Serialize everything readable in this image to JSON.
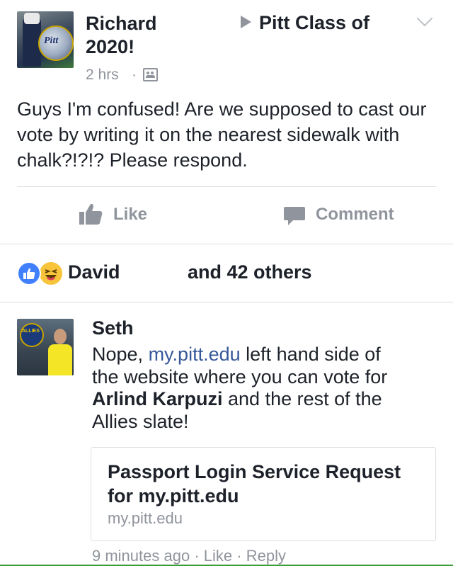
{
  "post": {
    "author_line1": "Richard",
    "author_line2": "2020!",
    "group_name": "Pitt Class of",
    "timestamp": "2 hrs",
    "separator": "·",
    "privacy_icon": "group-icon",
    "body": "Guys I'm confused! Are we supposed to cast our vote by writing it on the nearest sidewalk with chalk?!?!? Please respond.",
    "avatar_text": "Pitt"
  },
  "actions": {
    "like_label": "Like",
    "comment_label": "Comment"
  },
  "reactions": {
    "names": "David",
    "others": "and 42 others"
  },
  "comment": {
    "author": "Seth",
    "line1_prefix": "Nope, ",
    "line1_link": "my.pitt.edu",
    "line1_suffix": " left hand side of",
    "line2": "the website where you can vote for",
    "line3_bold": "Arlind Karpuzi",
    "line3_rest": " and the rest of the",
    "line4": "Allies slate!",
    "avatar_badge_text": "ALLIES",
    "link_preview": {
      "title": "Passport Login Service Request for my.pitt.edu",
      "domain": "my.pitt.edu"
    },
    "footer": {
      "time": "9 minutes ago",
      "like": "Like",
      "reply": "Reply",
      "separator": "·"
    }
  },
  "colors": {
    "text": "#1d2129",
    "muted": "#90949c",
    "link": "#365899",
    "like_blue": "#4080ff",
    "haha_yellow": "#f7c43b"
  }
}
